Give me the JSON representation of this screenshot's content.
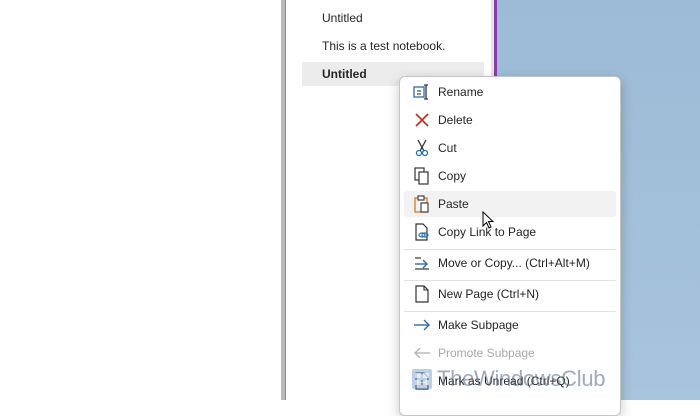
{
  "page_list": [
    {
      "label": "Untitled",
      "selected": false
    },
    {
      "label": "This is a test notebook.",
      "selected": false
    },
    {
      "label": "Untitled",
      "selected": true
    }
  ],
  "context_menu": {
    "items": [
      {
        "label": "Rename",
        "icon": "rename-icon",
        "state": "normal"
      },
      {
        "label": "Delete",
        "icon": "delete-x-icon",
        "state": "normal"
      },
      {
        "label": "Cut",
        "icon": "scissors-icon",
        "state": "normal"
      },
      {
        "label": "Copy",
        "icon": "copy-icon",
        "state": "normal"
      },
      {
        "label": "Paste",
        "icon": "clipboard-icon",
        "state": "hover"
      },
      {
        "label": "Copy Link to Page",
        "icon": "link-page-icon",
        "state": "normal"
      },
      {
        "label": "Move or Copy...  (Ctrl+Alt+M)",
        "icon": "move-arrow-icon",
        "state": "normal"
      },
      {
        "label": "New Page  (Ctrl+N)",
        "icon": "new-page-icon",
        "state": "normal"
      },
      {
        "label": "Make Subpage",
        "icon": "arrow-right-icon",
        "state": "normal"
      },
      {
        "label": "Promote Subpage",
        "icon": "arrow-left-icon",
        "state": "disabled"
      },
      {
        "label": "Mark as Unread  (Ctrl+Q)",
        "icon": "unread-page-icon",
        "state": "normal"
      }
    ]
  },
  "watermark": {
    "text": "TheWindowsClub"
  },
  "colors": {
    "accent_purple": "#8a3ea8",
    "delete_red": "#c42b1c",
    "icon_blue": "#2b6cb0",
    "paste_orange": "#d47a28"
  }
}
